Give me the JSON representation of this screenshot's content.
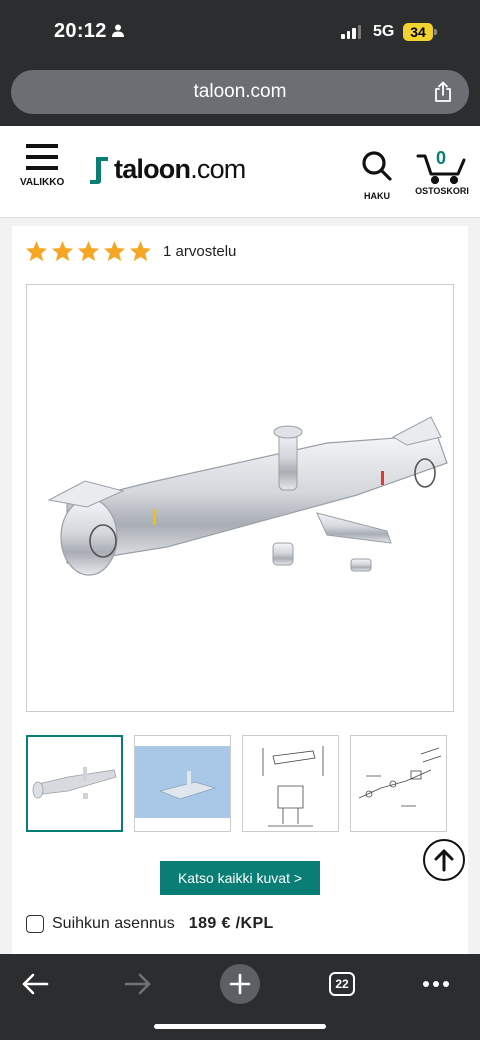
{
  "status_bar": {
    "time": "20:12",
    "network": "5G",
    "battery": "34"
  },
  "browser": {
    "url": "taloon.com",
    "tab_count": "22"
  },
  "header": {
    "menu_label": "VALIKKO",
    "logo_brand": "taloon",
    "logo_domain": ".com",
    "search_label": "HAKU",
    "cart_label": "OSTOSKORI",
    "cart_count": "0"
  },
  "product": {
    "rating_stars": 5,
    "reviews": "1 arvostelu",
    "all_images_button": "Katso kaikki kuvat >",
    "option_label": "Suihkun asennus",
    "option_price": "189 € /KPL"
  },
  "colors": {
    "accent": "#0a7e74",
    "star": "#f5a623"
  },
  "icons": [
    "person-icon",
    "share-icon",
    "hamburger-icon",
    "search-icon",
    "cart-icon",
    "star-icon",
    "arrow-up-icon",
    "back-arrow-icon",
    "forward-arrow-icon",
    "plus-icon",
    "more-icon"
  ]
}
